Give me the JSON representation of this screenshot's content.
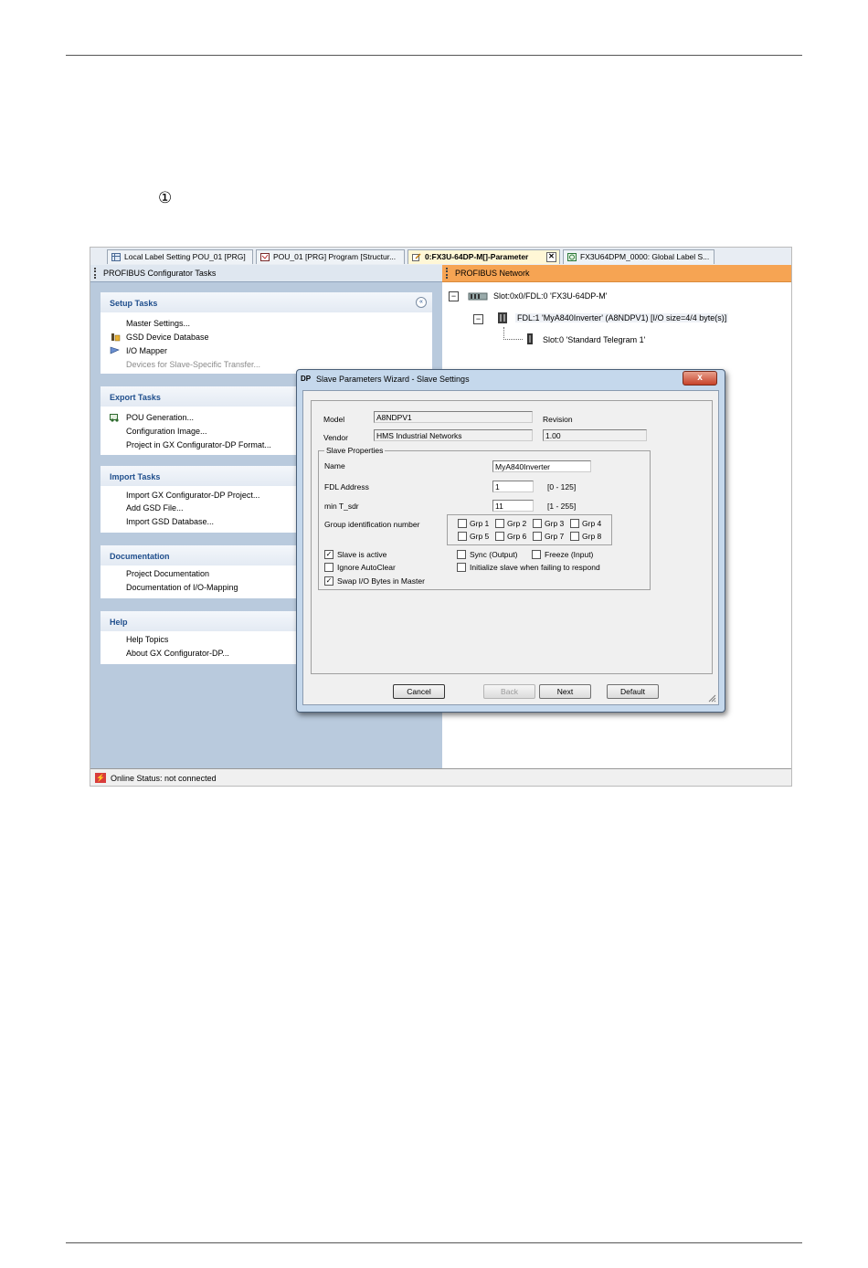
{
  "marker": "①",
  "tabs": [
    {
      "label": "Local Label Setting POU_01 [PRG]"
    },
    {
      "label": "POU_01 [PRG] Program [Structur..."
    },
    {
      "label": "0:FX3U-64DP-M[]-Parameter",
      "close": "✕"
    },
    {
      "label": "FX3U64DPM_0000: Global Label S..."
    }
  ],
  "left_pane": {
    "title": "PROFIBUS Configurator Tasks",
    "collapse_glyph": "«",
    "groups": [
      {
        "title": "Setup Tasks",
        "items": [
          "Master Settings...",
          "GSD Device Database",
          "I/O Mapper",
          "Devices for Slave-Specific Transfer..."
        ]
      },
      {
        "title": "Export Tasks",
        "items": [
          "POU Generation...",
          "Configuration Image...",
          "Project in GX Configurator-DP Format..."
        ]
      },
      {
        "title": "Import Tasks",
        "items": [
          "Import GX Configurator-DP Project...",
          "Add GSD File...",
          "Import GSD Database..."
        ]
      },
      {
        "title": "Documentation",
        "items": [
          "Project Documentation",
          "Documentation of I/O-Mapping"
        ]
      },
      {
        "title": "Help",
        "items": [
          "Help Topics",
          "About GX Configurator-DP..."
        ]
      }
    ]
  },
  "right_pane": {
    "title": "PROFIBUS Network",
    "tree": [
      "Slot:0x0/FDL:0 'FX3U-64DP-M'",
      "FDL:1 'MyA840Inverter' (A8NDPV1) [I/O size=4/4 byte(s)]",
      "Slot:0 'Standard Telegram 1'"
    ]
  },
  "dialog": {
    "icon": "DP",
    "title": "Slave Parameters Wizard - Slave Settings",
    "close": "x",
    "model_label": "Model",
    "model_value": "A8NDPV1",
    "revision_label": "Revision",
    "revision_value": "1.00",
    "vendor_label": "Vendor",
    "vendor_value": "HMS Industrial Networks",
    "slave_properties": "Slave Properties",
    "name_label": "Name",
    "name_value": "MyA840Inverter",
    "fdl_label": "FDL Address",
    "fdl_value": "1",
    "fdl_range": "[0 - 125]",
    "tsdr_label": "min T_sdr",
    "tsdr_value": "11",
    "tsdr_range": "[1 - 255]",
    "group_label": "Group identification number",
    "groups": [
      "Grp 1",
      "Grp 2",
      "Grp 3",
      "Grp 4",
      "Grp 5",
      "Grp 6",
      "Grp 7",
      "Grp 8"
    ],
    "options": {
      "slave_active": "Slave is active",
      "ignore_autoclear": "Ignore AutoClear",
      "swap_io": "Swap I/O Bytes in Master",
      "sync": "Sync (Output)",
      "freeze": "Freeze (Input)",
      "init_slave": "Initialize slave when failing to respond"
    },
    "check_mark": "✓",
    "buttons": {
      "cancel": "Cancel",
      "back": "Back",
      "next": "Next",
      "default": "Default"
    }
  },
  "status": {
    "text": "Online Status: not connected",
    "icon": "⚡"
  }
}
